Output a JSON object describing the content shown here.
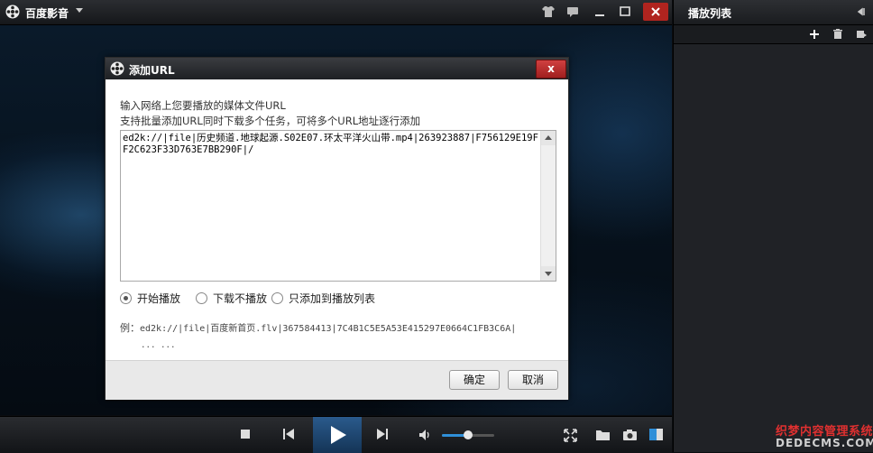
{
  "app": {
    "title": "百度影音"
  },
  "playlist": {
    "title": "播放列表"
  },
  "dialog": {
    "title": "添加URL",
    "close_label": "x",
    "hint_line1": "输入网络上您要播放的媒体文件URL",
    "hint_line2": "支持批量添加URL同时下载多个任务，可将多个URL地址逐行添加",
    "url_value": "ed2k://|file|历史频道.地球起源.S02E07.环太平洋火山带.mp4|263923887|F756129E19FF2C623F33D763E7BB290F|/",
    "options": [
      {
        "label": "开始播放",
        "selected": true
      },
      {
        "label": "下载不播放",
        "selected": false
      },
      {
        "label": "只添加到播放列表",
        "selected": false
      }
    ],
    "example_prefix": "例：",
    "example_value": "ed2k://|file|百度新首页.flv|367584413|7C4B1C5E5A53E415297E0664C1FB3C6A|",
    "example_more": "... ...",
    "ok_label": "确定",
    "cancel_label": "取消"
  },
  "volume": {
    "level": 0.5
  },
  "watermark": {
    "line1": "织梦内容管理系统",
    "line2": "DEDECMS.COM"
  },
  "colors": {
    "accent": "#2f8fd8",
    "close_red": "#b0241f"
  }
}
